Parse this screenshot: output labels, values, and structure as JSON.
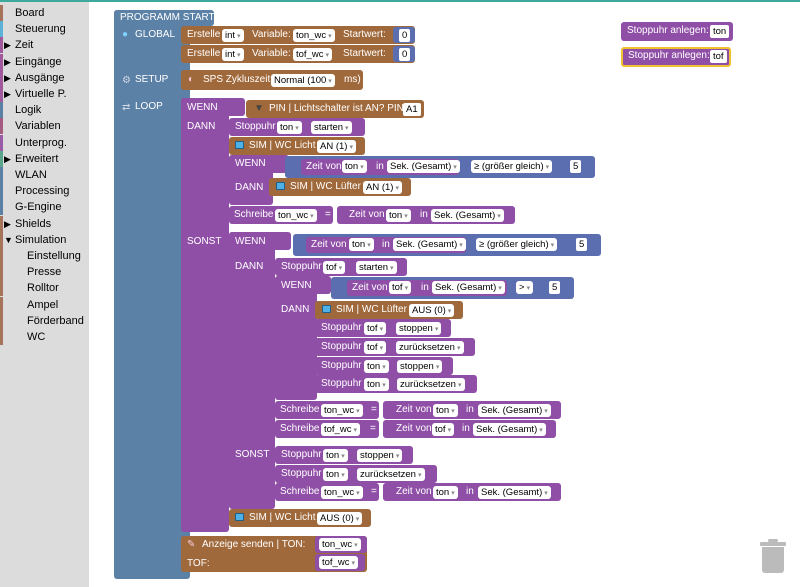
{
  "sidebar": {
    "items": [
      {
        "label": "Board",
        "color": "#a5745b",
        "arrow": ""
      },
      {
        "label": "Steuerung",
        "color": "#5cb1d6",
        "arrow": ""
      },
      {
        "label": "Zeit",
        "color": "#a05a9b",
        "arrow": "▶"
      },
      {
        "label": "Eingänge",
        "color": "#a05a9b",
        "arrow": "▶"
      },
      {
        "label": "Ausgänge",
        "color": "#a05a9b",
        "arrow": "▶"
      },
      {
        "label": "Virtuelle P.",
        "color": "#a05a9b",
        "arrow": "▶"
      },
      {
        "label": "Logik",
        "color": "#5b80a5",
        "arrow": ""
      },
      {
        "label": "Variablen",
        "color": "#a55b80",
        "arrow": ""
      },
      {
        "label": "Unterprog.",
        "color": "#995ba5",
        "arrow": ""
      },
      {
        "label": "Erweitert",
        "color": "#5ba58c",
        "arrow": "▶"
      },
      {
        "label": "WLAN",
        "color": "#5b80a5",
        "arrow": ""
      },
      {
        "label": "Processing",
        "color": "#5b80a5",
        "arrow": ""
      },
      {
        "label": "G-Engine",
        "color": "#5b80a5",
        "arrow": ""
      },
      {
        "label": "Shields",
        "color": "#a5745b",
        "arrow": "▶"
      },
      {
        "label": "Simulation",
        "color": "#a5745b",
        "arrow": "▼"
      },
      {
        "label": "Einstellung",
        "color": "#a5745b",
        "arrow": "",
        "sub": true
      },
      {
        "label": "Presse",
        "color": "#a5745b",
        "arrow": "",
        "sub": true
      },
      {
        "label": "Rolltor",
        "color": "#a5745b",
        "arrow": "",
        "sub": true
      },
      {
        "label": "Ampel",
        "color": "#a5745b",
        "arrow": "",
        "sub": true
      },
      {
        "label": "Förderband",
        "color": "#a5745b",
        "arrow": "",
        "sub": true
      },
      {
        "label": "WC",
        "color": "#a5745b",
        "arrow": "",
        "sub": true
      }
    ]
  },
  "program": {
    "title": "PROGRAMM START",
    "global_label": "GLOBAL",
    "setup_label": "SETUP",
    "loop_label": "LOOP",
    "global": [
      {
        "erstelle": "Erstelle",
        "type": "int",
        "variable_label": "Variable:",
        "variable": "ton_wc",
        "startwert_label": "Startwert:",
        "value": "0"
      },
      {
        "erstelle": "Erstelle",
        "type": "int",
        "variable_label": "Variable:",
        "variable": "tof_wc",
        "startwert_label": "Startwert:",
        "value": "0"
      }
    ],
    "setup": {
      "label": "SPS Zykluszeit",
      "value": "Normal (100",
      "unit": "ms)"
    },
    "wenn": "WENN",
    "dann": "DANN",
    "sonst": "SONST",
    "pin": {
      "label": "PIN | Lichtschalter ist AN? PIN",
      "pin": "A1"
    },
    "stoppuhr": "Stoppuhr",
    "starten": "starten",
    "stoppen": "stoppen",
    "zuruecksetzen": "zurücksetzen",
    "ton": "ton",
    "tof": "tof",
    "sim_wc_licht": "SIM | WC Licht",
    "sim_wc_luefter": "SIM | WC Lüfter",
    "an": "AN (1)",
    "aus": "AUS (0)",
    "zeit_von": "Zeit von",
    "in": "in",
    "sek_gesamt": "Sek. (Gesamt)",
    "ge": "≥ (größer gleich)",
    "gt": ">",
    "five": "5",
    "schreibe": "Schreibe",
    "eq": "=",
    "ton_wc": "ton_wc",
    "tof_wc": "tof_wc",
    "anzeige": "Anzeige senden | TON:",
    "tof_label": "TOF:"
  },
  "stoppuhr_blocks": [
    {
      "label": "Stoppuhr anlegen:",
      "name": "ton"
    },
    {
      "label": "Stoppuhr anlegen:",
      "name": "tof"
    }
  ],
  "colors": {
    "purple": "#8f4fa6",
    "brown": "#a0693b",
    "blue": "#5b6fb0",
    "loop": "#5c81a6",
    "sidebar_bg": "#dcdcdc",
    "accent": "#3ba99c"
  },
  "icons": {
    "trash": "trash-icon",
    "globe": "globe-icon",
    "gear": "gear-icon",
    "loop": "loop-icon"
  }
}
